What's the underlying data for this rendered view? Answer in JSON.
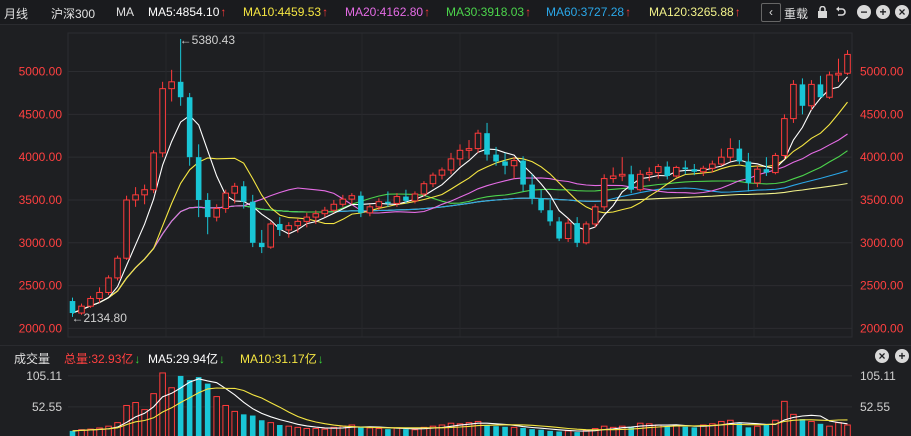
{
  "toolbar": {
    "period": "月线",
    "index_name": "沪深300",
    "indicator": "MA",
    "ma5": "MA5:4854.10",
    "ma10": "MA10:4459.53",
    "ma20": "MA20:4162.80",
    "ma30": "MA30:3918.03",
    "ma60": "MA60:3727.28",
    "ma120": "MA120:3265.88",
    "up_arrow": "↑",
    "restore_label": "重载",
    "colors": {
      "ma5": "#ffffff",
      "ma10": "#f5e642",
      "ma20": "#e56ce5",
      "ma30": "#4cd44c",
      "ma60": "#2aa7e8",
      "ma120": "#f2f28a"
    }
  },
  "price_axis": {
    "ticks": [
      "5000.00",
      "4500.00",
      "4000.00",
      "3500.00",
      "3000.00",
      "2500.00",
      "2000.00"
    ],
    "color": "#ff4040"
  },
  "annotations": {
    "high": "←5380.43",
    "low": "←2134.80"
  },
  "volume_panel": {
    "title": "成交量",
    "total": "总量:32.93亿",
    "ma5": "MA5:29.94亿",
    "ma10": "MA10:31.17亿",
    "down_arrow": "↓",
    "ticks": [
      "105.11",
      "52.55"
    ]
  },
  "chart_data": {
    "type": "candlestick",
    "ylim": [
      1900,
      5450
    ],
    "candles": [
      {
        "o": 2320,
        "h": 2360,
        "l": 2134.8,
        "c": 2180
      },
      {
        "o": 2180,
        "h": 2290,
        "l": 2160,
        "c": 2260
      },
      {
        "o": 2260,
        "h": 2380,
        "l": 2240,
        "c": 2350
      },
      {
        "o": 2350,
        "h": 2480,
        "l": 2300,
        "c": 2420
      },
      {
        "o": 2420,
        "h": 2620,
        "l": 2390,
        "c": 2590
      },
      {
        "o": 2590,
        "h": 2850,
        "l": 2560,
        "c": 2820
      },
      {
        "o": 2820,
        "h": 3550,
        "l": 2800,
        "c": 3500
      },
      {
        "o": 3500,
        "h": 3650,
        "l": 3420,
        "c": 3560
      },
      {
        "o": 3560,
        "h": 3680,
        "l": 3450,
        "c": 3620
      },
      {
        "o": 3620,
        "h": 4080,
        "l": 3580,
        "c": 4050
      },
      {
        "o": 4050,
        "h": 4880,
        "l": 4000,
        "c": 4800
      },
      {
        "o": 4800,
        "h": 5020,
        "l": 4650,
        "c": 4880
      },
      {
        "o": 4880,
        "h": 5380.43,
        "l": 4600,
        "c": 4700
      },
      {
        "o": 4700,
        "h": 4750,
        "l": 3900,
        "c": 4000
      },
      {
        "o": 4000,
        "h": 4150,
        "l": 3300,
        "c": 3500
      },
      {
        "o": 3500,
        "h": 3580,
        "l": 3100,
        "c": 3300
      },
      {
        "o": 3300,
        "h": 3450,
        "l": 3250,
        "c": 3400
      },
      {
        "o": 3400,
        "h": 3620,
        "l": 3350,
        "c": 3580
      },
      {
        "o": 3580,
        "h": 3700,
        "l": 3460,
        "c": 3660
      },
      {
        "o": 3660,
        "h": 3720,
        "l": 3400,
        "c": 3480
      },
      {
        "o": 3480,
        "h": 3560,
        "l": 2950,
        "c": 3000
      },
      {
        "o": 3000,
        "h": 3150,
        "l": 2880,
        "c": 2950
      },
      {
        "o": 2950,
        "h": 3250,
        "l": 2930,
        "c": 3220
      },
      {
        "o": 3220,
        "h": 3300,
        "l": 3080,
        "c": 3150
      },
      {
        "o": 3150,
        "h": 3240,
        "l": 3060,
        "c": 3200
      },
      {
        "o": 3200,
        "h": 3280,
        "l": 3120,
        "c": 3250
      },
      {
        "o": 3250,
        "h": 3350,
        "l": 3180,
        "c": 3300
      },
      {
        "o": 3300,
        "h": 3380,
        "l": 3220,
        "c": 3340
      },
      {
        "o": 3340,
        "h": 3420,
        "l": 3300,
        "c": 3380
      },
      {
        "o": 3380,
        "h": 3500,
        "l": 3350,
        "c": 3450
      },
      {
        "o": 3450,
        "h": 3560,
        "l": 3420,
        "c": 3510
      },
      {
        "o": 3510,
        "h": 3580,
        "l": 3450,
        "c": 3550
      },
      {
        "o": 3550,
        "h": 3600,
        "l": 3300,
        "c": 3350
      },
      {
        "o": 3350,
        "h": 3450,
        "l": 3310,
        "c": 3420
      },
      {
        "o": 3420,
        "h": 3520,
        "l": 3380,
        "c": 3480
      },
      {
        "o": 3480,
        "h": 3600,
        "l": 3420,
        "c": 3460
      },
      {
        "o": 3460,
        "h": 3580,
        "l": 3420,
        "c": 3540
      },
      {
        "o": 3540,
        "h": 3620,
        "l": 3460,
        "c": 3490
      },
      {
        "o": 3490,
        "h": 3600,
        "l": 3460,
        "c": 3570
      },
      {
        "o": 3570,
        "h": 3720,
        "l": 3540,
        "c": 3690
      },
      {
        "o": 3690,
        "h": 3820,
        "l": 3650,
        "c": 3790
      },
      {
        "o": 3790,
        "h": 3880,
        "l": 3740,
        "c": 3850
      },
      {
        "o": 3850,
        "h": 4050,
        "l": 3800,
        "c": 3980
      },
      {
        "o": 3980,
        "h": 4150,
        "l": 3900,
        "c": 4080
      },
      {
        "o": 4080,
        "h": 4200,
        "l": 3980,
        "c": 4100
      },
      {
        "o": 4100,
        "h": 4320,
        "l": 4050,
        "c": 4280
      },
      {
        "o": 4280,
        "h": 4400,
        "l": 3960,
        "c": 4030
      },
      {
        "o": 4030,
        "h": 4120,
        "l": 3900,
        "c": 3950
      },
      {
        "o": 3950,
        "h": 4050,
        "l": 3800,
        "c": 3900
      },
      {
        "o": 3900,
        "h": 4000,
        "l": 3750,
        "c": 3960
      },
      {
        "o": 3960,
        "h": 4010,
        "l": 3600,
        "c": 3680
      },
      {
        "o": 3680,
        "h": 3800,
        "l": 3450,
        "c": 3520
      },
      {
        "o": 3520,
        "h": 3620,
        "l": 3350,
        "c": 3380
      },
      {
        "o": 3380,
        "h": 3500,
        "l": 3200,
        "c": 3250
      },
      {
        "o": 3250,
        "h": 3300,
        "l": 3020,
        "c": 3050
      },
      {
        "o": 3050,
        "h": 3280,
        "l": 3010,
        "c": 3230
      },
      {
        "o": 3230,
        "h": 3300,
        "l": 2950,
        "c": 3000
      },
      {
        "o": 3000,
        "h": 3250,
        "l": 2980,
        "c": 3220
      },
      {
        "o": 3220,
        "h": 3450,
        "l": 3180,
        "c": 3420
      },
      {
        "o": 3420,
        "h": 3800,
        "l": 3380,
        "c": 3750
      },
      {
        "o": 3750,
        "h": 3880,
        "l": 3700,
        "c": 3780
      },
      {
        "o": 3780,
        "h": 4000,
        "l": 3720,
        "c": 3800
      },
      {
        "o": 3800,
        "h": 3900,
        "l": 3580,
        "c": 3620
      },
      {
        "o": 3620,
        "h": 3850,
        "l": 3600,
        "c": 3800
      },
      {
        "o": 3800,
        "h": 3880,
        "l": 3720,
        "c": 3820
      },
      {
        "o": 3820,
        "h": 3920,
        "l": 3750,
        "c": 3890
      },
      {
        "o": 3890,
        "h": 3950,
        "l": 3740,
        "c": 3780
      },
      {
        "o": 3780,
        "h": 3900,
        "l": 3760,
        "c": 3880
      },
      {
        "o": 3880,
        "h": 3960,
        "l": 3800,
        "c": 3860
      },
      {
        "o": 3860,
        "h": 3920,
        "l": 3790,
        "c": 3830
      },
      {
        "o": 3830,
        "h": 3900,
        "l": 3780,
        "c": 3870
      },
      {
        "o": 3870,
        "h": 3960,
        "l": 3820,
        "c": 3920
      },
      {
        "o": 3920,
        "h": 4100,
        "l": 3900,
        "c": 4000
      },
      {
        "o": 4000,
        "h": 4220,
        "l": 3950,
        "c": 4100
      },
      {
        "o": 4100,
        "h": 4200,
        "l": 3920,
        "c": 3950
      },
      {
        "o": 3950,
        "h": 4050,
        "l": 3600,
        "c": 3700
      },
      {
        "o": 3700,
        "h": 3900,
        "l": 3650,
        "c": 3860
      },
      {
        "o": 3860,
        "h": 4000,
        "l": 3780,
        "c": 3820
      },
      {
        "o": 3820,
        "h": 4050,
        "l": 3800,
        "c": 4020
      },
      {
        "o": 4020,
        "h": 4500,
        "l": 3980,
        "c": 4450
      },
      {
        "o": 4450,
        "h": 4900,
        "l": 4400,
        "c": 4850
      },
      {
        "o": 4850,
        "h": 4920,
        "l": 4500,
        "c": 4600
      },
      {
        "o": 4600,
        "h": 4900,
        "l": 4550,
        "c": 4850
      },
      {
        "o": 4850,
        "h": 4950,
        "l": 4700,
        "c": 4700
      },
      {
        "o": 4700,
        "h": 5000,
        "l": 4680,
        "c": 4960
      },
      {
        "o": 4960,
        "h": 5150,
        "l": 4880,
        "c": 4980
      },
      {
        "o": 4980,
        "h": 5250,
        "l": 4960,
        "c": 5200
      }
    ],
    "volume_ylim": [
      0,
      115
    ],
    "volumes": [
      12,
      14,
      15,
      17,
      20,
      26,
      55,
      60,
      48,
      75,
      110,
      85,
      105,
      98,
      103,
      92,
      70,
      55,
      45,
      40,
      38,
      30,
      26,
      22,
      20,
      18,
      16,
      16,
      15,
      18,
      20,
      22,
      18,
      17,
      16,
      15,
      17,
      15,
      14,
      18,
      20,
      22,
      25,
      24,
      26,
      28,
      22,
      20,
      19,
      18,
      17,
      15,
      14,
      12,
      11,
      12,
      10,
      13,
      16,
      20,
      18,
      20,
      18,
      25,
      24,
      22,
      20,
      21,
      19,
      18,
      22,
      24,
      28,
      30,
      25,
      18,
      20,
      22,
      30,
      62,
      40,
      32,
      28,
      24,
      20,
      26,
      22
    ]
  }
}
